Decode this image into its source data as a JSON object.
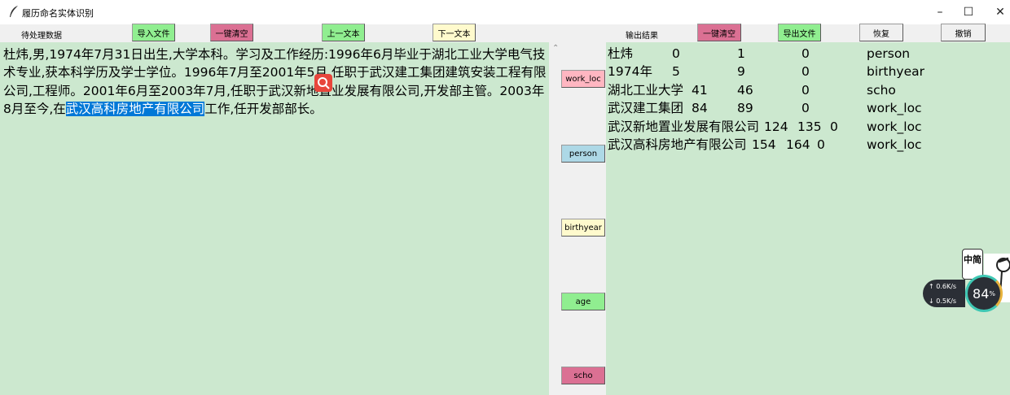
{
  "window": {
    "title": "履历命名实体识别",
    "minimize": "–",
    "maximize": "☐",
    "close": "✕"
  },
  "left_toolbar": {
    "label": "待处理数据",
    "import_button": "导入文件",
    "clear_button": "一键清空",
    "prev_button": "上一文本",
    "next_button": "下一文本"
  },
  "right_toolbar": {
    "label": "输出结果",
    "clear_button": "一键清空",
    "export_button": "导出文件",
    "restore_button": "恢复",
    "undo_button": "撤销"
  },
  "input": {
    "text_before_selection": "杜炜,男,1974年7月31日出生,大学本科。学习及工作经历:1996年6月毕业于湖北工业大学电气技术专业,获本科学历及学士学位。1996年7月至2001年5月,任职于武汉建工集团建筑安装工程有限公司,工程师。2001年6月至2003年7月,任职于武汉新地置业发展有限公司,开发部主管。2003年8月至今,在",
    "selected_text": "武汉高科房地产有限公司",
    "text_after_selection": "工作,任开发部部长。"
  },
  "label_buttons": [
    "work_loc",
    "person",
    "birthyear",
    "age",
    "scho"
  ],
  "results": [
    {
      "entity": "杜炜",
      "start": "0",
      "end": "1",
      "flag": "0",
      "label": "person"
    },
    {
      "entity": "1974年",
      "start": "5",
      "end": "9",
      "flag": "0",
      "label": "birthyear"
    },
    {
      "entity": "湖北工业大学",
      "start": "41",
      "end": "46",
      "flag": "0",
      "label": "scho"
    },
    {
      "entity": "武汉建工集团",
      "start": "84",
      "end": "89",
      "flag": "0",
      "label": "work_loc"
    },
    {
      "entity": "武汉新地置业发展有限公司",
      "start": "124",
      "end": "135",
      "flag": "0",
      "label": "work_loc"
    },
    {
      "entity": "武汉高科房地产有限公司",
      "start": "154",
      "end": "164",
      "flag": "0",
      "label": "work_loc"
    }
  ],
  "overlay": {
    "net_up": "↑ 0.6K/s",
    "net_down": "↓ 0.5K/s",
    "percent": "84",
    "percent_sign": "%",
    "ime": "中简"
  },
  "colors": {
    "pane_bg": "#cce8cf",
    "green_button": "#90ee90",
    "pink_button": "#db7093",
    "cream_button": "#fffacd",
    "selection": "#0078d7"
  }
}
